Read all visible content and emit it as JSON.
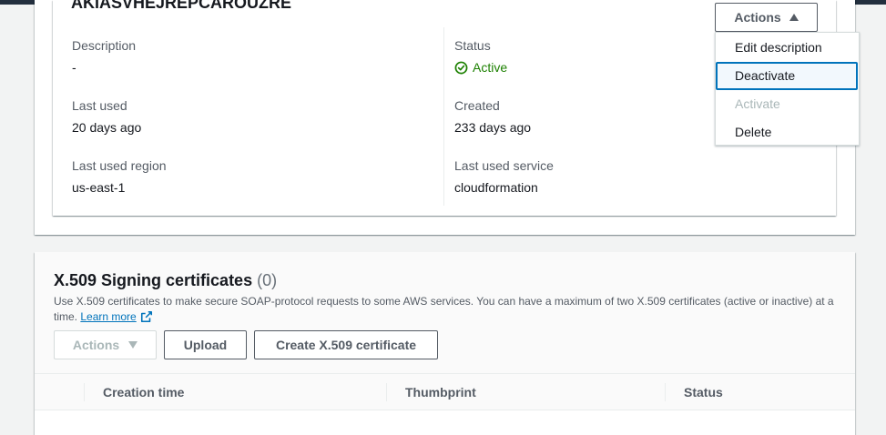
{
  "access_key": {
    "id_partial": "AKIASVHEJREPCAROUZRE",
    "fields": {
      "description": {
        "label": "Description",
        "value": "-"
      },
      "status": {
        "label": "Status",
        "value": "Active"
      },
      "last_used": {
        "label": "Last used",
        "value": "20 days ago"
      },
      "created": {
        "label": "Created",
        "value": "233 days ago"
      },
      "last_used_region": {
        "label": "Last used region",
        "value": "us-east-1"
      },
      "last_used_service": {
        "label": "Last used service",
        "value": "cloudformation"
      }
    },
    "actions_label": "Actions",
    "menu": {
      "edit_description": "Edit description",
      "deactivate": "Deactivate",
      "activate": "Activate",
      "delete": "Delete"
    }
  },
  "certificates": {
    "title": "X.509 Signing certificates",
    "count": "(0)",
    "description": "Use X.509 certificates to make secure SOAP-protocol requests to some AWS services. You can have a maximum of two X.509 certificates (active or inactive) at a time.",
    "learn_more": "Learn more",
    "actions_label": "Actions",
    "upload_label": "Upload",
    "create_label": "Create X.509 certificate",
    "columns": [
      "Creation time",
      "Thumbprint",
      "Status"
    ]
  },
  "colors": {
    "status_active": "#1d8102",
    "link": "#0073bb",
    "focus": "#0073bb"
  }
}
